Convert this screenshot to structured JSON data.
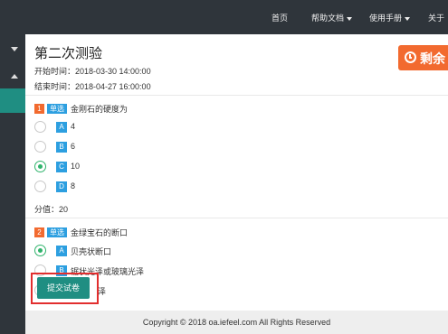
{
  "nav": {
    "home": "首页",
    "help_docs": "帮助文档",
    "user_manual": "使用手册",
    "about": "关于"
  },
  "exam": {
    "title": "第二次测验",
    "start_time": "开始时间：2018-03-30 14:00:00",
    "end_time": "结束时间：2018-04-27 16:00:00",
    "remaining_label": "剩余"
  },
  "questions": [
    {
      "number": "1",
      "type": "单选",
      "text": "金刚石的硬度为",
      "options": [
        {
          "letter": "A",
          "text": "4",
          "checked": false
        },
        {
          "letter": "B",
          "text": "6",
          "checked": false
        },
        {
          "letter": "C",
          "text": "10",
          "checked": true
        },
        {
          "letter": "D",
          "text": "8",
          "checked": false
        }
      ],
      "score": "分值：20"
    },
    {
      "number": "2",
      "type": "单选",
      "text": "金绿宝石的断口",
      "options": [
        {
          "letter": "A",
          "text": "贝壳状断口",
          "checked": true
        },
        {
          "letter": "B",
          "text": "锯状光泽或玻璃光泽",
          "checked": false
        },
        {
          "letter": "C",
          "text": "泽",
          "checked": false
        }
      ]
    }
  ],
  "submit_label": "提交试卷",
  "footer": "Copyright © 2018 oa.iefeel.com All Rights Reserved",
  "colors": {
    "nav_bg": "#2f353b",
    "accent_teal": "#1f8e82",
    "timer_orange": "#f26a2f",
    "option_blue": "#2d9fe0",
    "radio_green": "#2fb36b",
    "highlight_red": "#e22e2e"
  }
}
